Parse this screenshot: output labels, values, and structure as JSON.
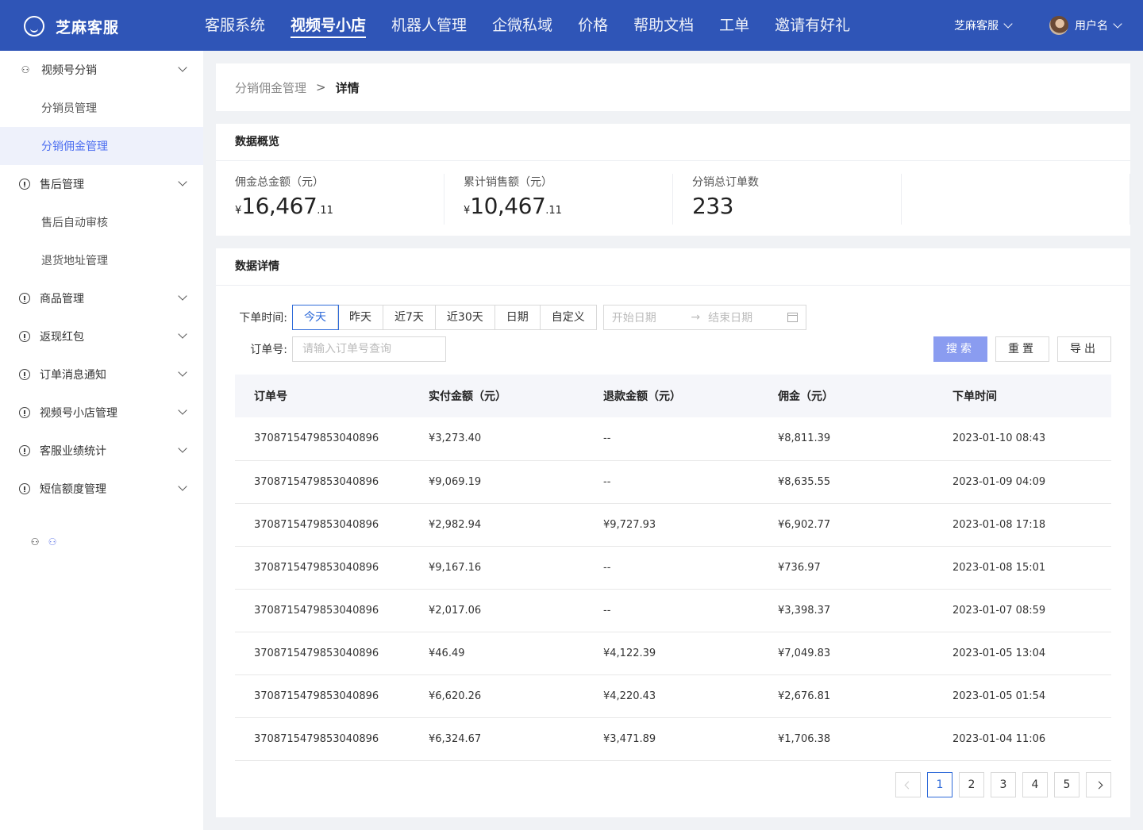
{
  "brand": {
    "name": "芝麻客服"
  },
  "nav": {
    "items": [
      "客服系统",
      "视频号小店",
      "机器人管理",
      "企微私域",
      "价格",
      "帮助文档",
      "工单",
      "邀请有好礼"
    ],
    "active_index": 1
  },
  "account": {
    "name": "芝麻客服",
    "user": "用户名"
  },
  "sidebar": {
    "group_video": "视频号分销",
    "sub_distributors": "分销员管理",
    "sub_commission": "分销佣金管理",
    "group_aftersale": "售后管理",
    "sub_auto_review": "售后自动审核",
    "sub_return_addr": "退货地址管理",
    "group_goods": "商品管理",
    "group_cashback": "返现红包",
    "group_order_notice": "订单消息通知",
    "group_shop": "视频号小店管理",
    "group_stats": "客服业绩统计",
    "group_sms": "短信额度管理"
  },
  "breadcrumb": {
    "parent": "分销佣金管理",
    "separator": ">",
    "current": "详情"
  },
  "overview": {
    "title": "数据概览",
    "commission_label": "佣金总金额（元）",
    "commission_currency": "¥",
    "commission_int": "16,467",
    "commission_dec": ".11",
    "sales_label": "累计销售额（元）",
    "sales_currency": "¥",
    "sales_int": "10,467",
    "sales_dec": ".11",
    "orders_label": "分销总订单数",
    "orders_value": "233"
  },
  "detail": {
    "title": "数据详情",
    "time_label": "下单时间:",
    "ranges": [
      "今天",
      "昨天",
      "近7天",
      "近30天",
      "日期",
      "自定义"
    ],
    "active_range": 0,
    "start_placeholder": "开始日期",
    "end_placeholder": "结束日期",
    "order_label": "订单号:",
    "order_placeholder": "请输入订单号查询",
    "search_btn": "搜索",
    "reset_btn": "重置",
    "export_btn": "导出"
  },
  "table": {
    "headers": [
      "订单号",
      "实付金额（元）",
      "退款金额（元）",
      "佣金（元）",
      "下单时间"
    ],
    "rows": [
      [
        "3708715479853040896",
        "¥3,273.40",
        "--",
        "¥8,811.39",
        "2023-01-10 08:43"
      ],
      [
        "3708715479853040896",
        "¥9,069.19",
        "--",
        "¥8,635.55",
        "2023-01-09 04:09"
      ],
      [
        "3708715479853040896",
        "¥2,982.94",
        "¥9,727.93",
        "¥6,902.77",
        "2023-01-08 17:18"
      ],
      [
        "3708715479853040896",
        "¥9,167.16",
        "--",
        "¥736.97",
        "2023-01-08 15:01"
      ],
      [
        "3708715479853040896",
        "¥2,017.06",
        "--",
        "¥3,398.37",
        "2023-01-07 08:59"
      ],
      [
        "3708715479853040896",
        "¥46.49",
        "¥4,122.39",
        "¥7,049.83",
        "2023-01-05 13:04"
      ],
      [
        "3708715479853040896",
        "¥6,620.26",
        "¥4,220.43",
        "¥2,676.81",
        "2023-01-05 01:54"
      ],
      [
        "3708715479853040896",
        "¥6,324.67",
        "¥3,471.89",
        "¥1,706.38",
        "2023-01-04 11:06"
      ]
    ]
  },
  "pagination": {
    "pages": [
      "1",
      "2",
      "3",
      "4",
      "5"
    ],
    "current": "1"
  }
}
